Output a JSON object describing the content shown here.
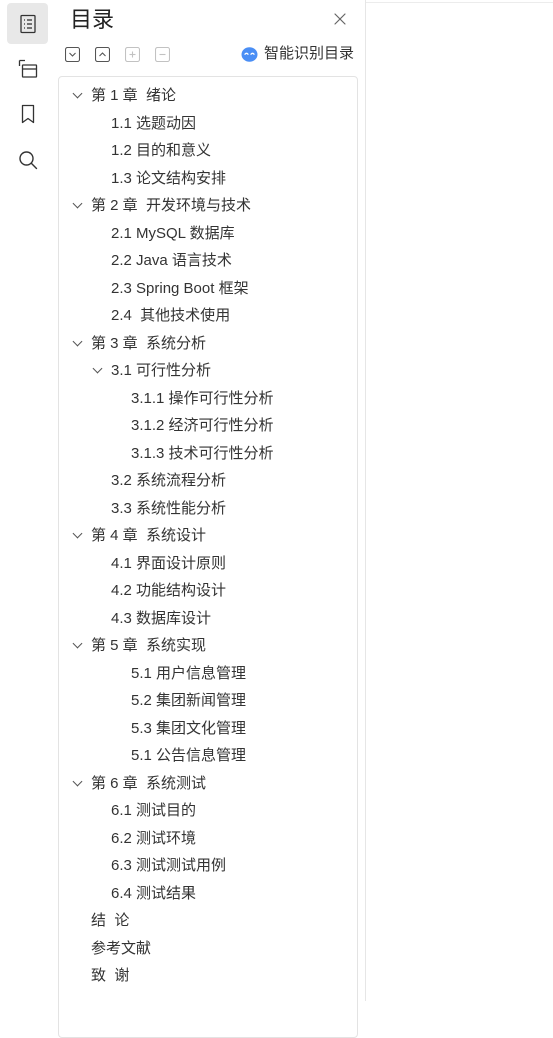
{
  "rail": {
    "items": [
      {
        "icon": "toc-icon",
        "active": true
      },
      {
        "icon": "thumbnail-icon",
        "active": false
      },
      {
        "icon": "bookmark-icon",
        "active": false
      },
      {
        "icon": "search-icon",
        "active": false
      }
    ]
  },
  "panel": {
    "title": "目录",
    "close_icon": "close-icon",
    "toolbar": [
      {
        "icon": "expand-all-icon",
        "enabled": true
      },
      {
        "icon": "collapse-all-icon",
        "enabled": true
      },
      {
        "icon": "plus-icon",
        "enabled": false
      },
      {
        "icon": "minus-icon",
        "enabled": false
      }
    ],
    "smart_toc": {
      "icon": "ai-assistant-icon",
      "label": "智能识别目录"
    }
  },
  "toc": [
    {
      "label": "第 1 章  绪论",
      "depth": 1,
      "expandable": true,
      "expanded": true
    },
    {
      "label": "1.1 选题动因",
      "depth": 2
    },
    {
      "label": "1.2 目的和意义",
      "depth": 2
    },
    {
      "label": "1.3 论文结构安排",
      "depth": 2
    },
    {
      "label": "第 2 章  开发环境与技术",
      "depth": 1,
      "expandable": true,
      "expanded": true
    },
    {
      "label": "2.1 MySQL 数据库",
      "depth": 2
    },
    {
      "label": "2.2 Java 语言技术",
      "depth": 2
    },
    {
      "label": "2.3 Spring Boot 框架",
      "depth": 2
    },
    {
      "label": "2.4  其他技术使用",
      "depth": 2
    },
    {
      "label": "第 3 章  系统分析",
      "depth": 1,
      "expandable": true,
      "expanded": true
    },
    {
      "label": "3.1 可行性分析",
      "depth": 2,
      "expandable": true,
      "expanded": true
    },
    {
      "label": "3.1.1 操作可行性分析",
      "depth": 3
    },
    {
      "label": "3.1.2 经济可行性分析",
      "depth": 3
    },
    {
      "label": "3.1.3 技术可行性分析",
      "depth": 3
    },
    {
      "label": "3.2 系统流程分析",
      "depth": 2
    },
    {
      "label": "3.3 系统性能分析",
      "depth": 2
    },
    {
      "label": "第 4 章  系统设计",
      "depth": 1,
      "expandable": true,
      "expanded": true
    },
    {
      "label": "4.1 界面设计原则",
      "depth": 2
    },
    {
      "label": "4.2 功能结构设计",
      "depth": 2
    },
    {
      "label": "4.3 数据库设计",
      "depth": 2
    },
    {
      "label": "第 5 章  系统实现",
      "depth": 1,
      "expandable": true,
      "expanded": true
    },
    {
      "label": "5.1 用户信息管理",
      "depth": 3
    },
    {
      "label": "5.2 集团新闻管理",
      "depth": 3
    },
    {
      "label": "5.3 集团文化管理",
      "depth": 3
    },
    {
      "label": "5.1 公告信息管理",
      "depth": 3
    },
    {
      "label": "第 6 章  系统测试",
      "depth": 1,
      "expandable": true,
      "expanded": true
    },
    {
      "label": "6.1 测试目的",
      "depth": 2
    },
    {
      "label": "6.2 测试环境",
      "depth": 2
    },
    {
      "label": "6.3 测试测试用例",
      "depth": 2
    },
    {
      "label": "6.4 测试结果",
      "depth": 2
    },
    {
      "label": "结  论",
      "depth": 1
    },
    {
      "label": "参考文献",
      "depth": 1
    },
    {
      "label": "致  谢",
      "depth": 1
    }
  ],
  "colors": {
    "accent": "#4a8ef5",
    "text": "#333333",
    "active_rail_bg": "#e8e8e8",
    "border": "#e3e3e3"
  }
}
